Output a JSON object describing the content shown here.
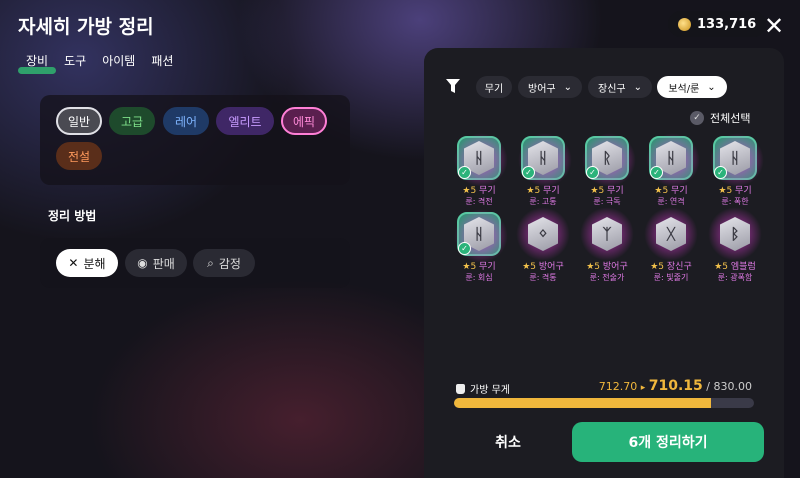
{
  "title": "자세히 가방 정리",
  "tabs": [
    "장비",
    "도구",
    "아이템",
    "패션"
  ],
  "gold": "133,716",
  "close_label": "✕",
  "grades": [
    {
      "label": "일반",
      "text": "#ffffff",
      "bg": "#4a4a52",
      "border": "#e0e0e6"
    },
    {
      "label": "고급",
      "text": "#7ee08a",
      "bg": "#1e4a2c",
      "border": "#1e4a2c"
    },
    {
      "label": "레어",
      "text": "#7fb5ff",
      "bg": "#1f3a66",
      "border": "#1f3a66"
    },
    {
      "label": "엘리트",
      "text": "#c79bff",
      "bg": "#3f2766",
      "border": "#3f2766"
    },
    {
      "label": "에픽",
      "text": "#ff8ad8",
      "bg": "#5a1f4e",
      "border": "#ff7fd6"
    },
    {
      "label": "전설",
      "text": "#ff9a5c",
      "bg": "#5a2e1a",
      "border": "#5a2e1a"
    }
  ],
  "sort_label": "정리 방법",
  "methods": [
    {
      "label": "분해",
      "icon": "✕",
      "active": true
    },
    {
      "label": "판매",
      "icon": "◉",
      "active": false
    },
    {
      "label": "감정",
      "icon": "⌕",
      "active": false
    }
  ],
  "filters": [
    "무기",
    "방어구",
    "장신구",
    "보석/룬"
  ],
  "select_all": "전체선택",
  "items": [
    {
      "rune": "ᚺ",
      "star": "★5",
      "type": "무기",
      "name": "룬: 격전",
      "selected": true
    },
    {
      "rune": "ᚺ",
      "star": "★5",
      "type": "무기",
      "name": "룬: 고통",
      "selected": true
    },
    {
      "rune": "ᚱ",
      "star": "★5",
      "type": "무기",
      "name": "룬: 극독",
      "selected": true
    },
    {
      "rune": "ᚺ",
      "star": "★5",
      "type": "무기",
      "name": "룬: 연격",
      "selected": true
    },
    {
      "rune": "ᚺ",
      "star": "★5",
      "type": "무기",
      "name": "룬: 폭한",
      "selected": true
    },
    {
      "rune": "ᚺ",
      "star": "★5",
      "type": "무기",
      "name": "룬: 회심",
      "selected": true
    },
    {
      "rune": "ᛜ",
      "star": "★5",
      "type": "방어구",
      "name": "룬: 격통",
      "selected": false
    },
    {
      "rune": "ᛉ",
      "star": "★5",
      "type": "방어구",
      "name": "룬: 전술가",
      "selected": false
    },
    {
      "rune": "ᚷ",
      "star": "★5",
      "type": "장신구",
      "name": "룬: 빛줄기",
      "selected": false
    },
    {
      "rune": "ᛒ",
      "star": "★5",
      "type": "엠블럼",
      "name": "룬: 광폭함",
      "selected": false
    }
  ],
  "weight_label": "가방 무게",
  "weight_before": "712.70",
  "weight_arrow": "▸",
  "weight_after": "710.15",
  "weight_max": "/ 830.00",
  "weight_fraction": 0.8556,
  "cancel_label": "취소",
  "confirm_label": "6개 정리하기"
}
